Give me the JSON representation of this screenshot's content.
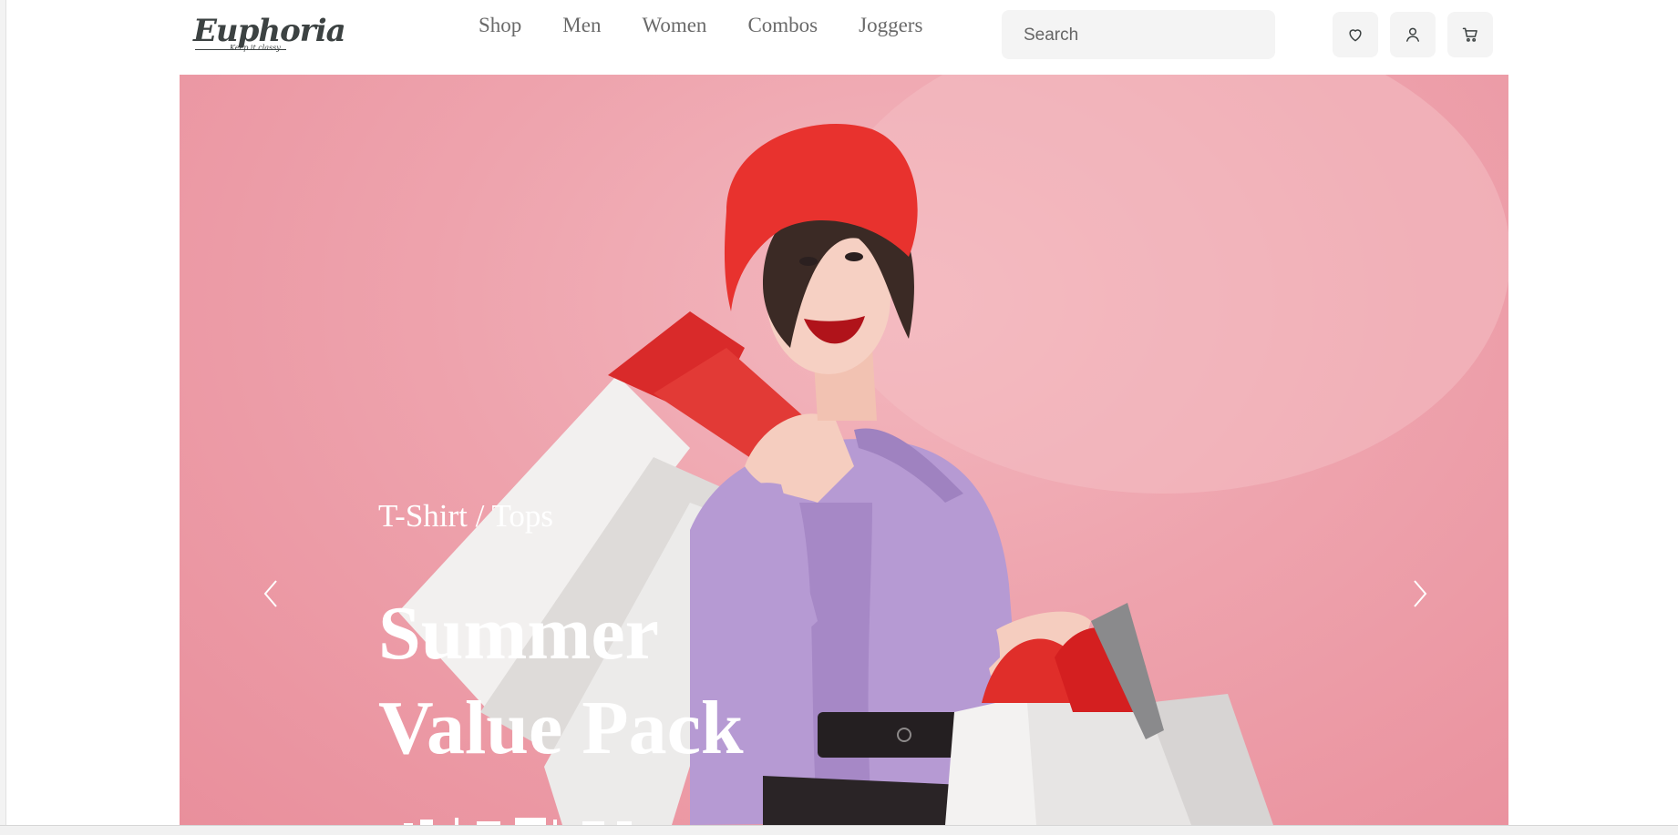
{
  "brand": {
    "name": "Euphoria",
    "tagline": "Keep it classy"
  },
  "nav": {
    "items": [
      {
        "label": "Shop"
      },
      {
        "label": "Men"
      },
      {
        "label": "Women"
      },
      {
        "label": "Combos"
      },
      {
        "label": "Joggers"
      }
    ]
  },
  "search": {
    "placeholder": "Search"
  },
  "actions": {
    "icons": [
      "heart-icon",
      "user-icon",
      "cart-icon"
    ]
  },
  "hero": {
    "category": "T-Shirt / Tops",
    "title_line1": "Summer",
    "title_line2": "Value Pack"
  },
  "colors": {
    "hero_bg": "#ee9faa",
    "beret": "#e8322e",
    "blouse": "#b69ad3",
    "text_dark": "#3c4242"
  }
}
